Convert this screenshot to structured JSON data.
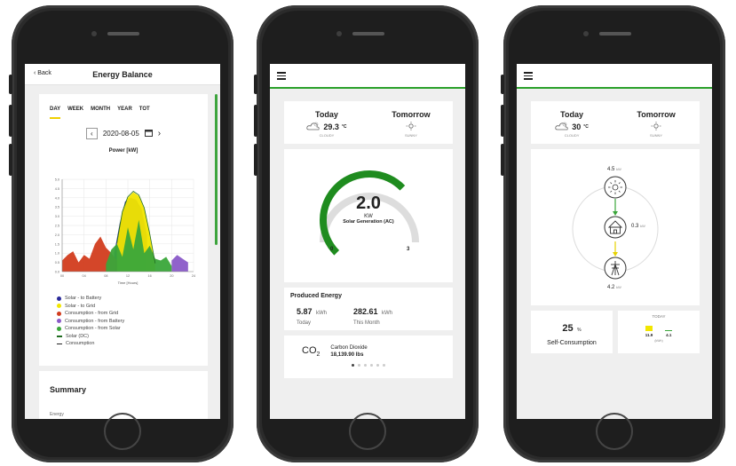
{
  "phone1": {
    "back_label": "Back",
    "title": "Energy Balance",
    "tabs": [
      "DAY",
      "WEEK",
      "MONTH",
      "YEAR",
      "TOT"
    ],
    "active_tab": "DAY",
    "date": "2020-08-05",
    "chart_title": "Power [kW]",
    "summary_title": "Summary",
    "summary_sub": "Energy",
    "chart_data": {
      "type": "area",
      "title": "Power [kW]",
      "xlabel": "Time [Hours]",
      "ylabel": "",
      "x_ticks": [
        "00",
        "04",
        "08",
        "12",
        "16",
        "20",
        "24"
      ],
      "y_ticks": [
        "0.0",
        "0.5",
        "1.0",
        "1.5",
        "2.0",
        "2.5",
        "3.0",
        "3.5",
        "4.0",
        "4.5",
        "5.0"
      ],
      "xlim": [
        0,
        24
      ],
      "ylim": [
        0,
        5
      ],
      "series": [
        {
          "name": "Solar - to Battery",
          "color": "#2a2a9a",
          "x": [
            9.5,
            10.5,
            11.5,
            12.5,
            13.5,
            14.5,
            15.5
          ],
          "y": [
            1.0,
            2.6,
            3.8,
            4.0,
            3.9,
            3.4,
            2.0
          ]
        },
        {
          "name": "Solar - to Grid",
          "color": "#f2e600",
          "x": [
            10,
            11,
            12,
            13,
            14,
            15,
            16,
            17
          ],
          "y": [
            1.5,
            3.2,
            4.0,
            4.3,
            4.1,
            3.4,
            2.0,
            0.4
          ]
        },
        {
          "name": "Consumption - from Grid",
          "color": "#d23c1e",
          "x": [
            0,
            1,
            2,
            3,
            4,
            5,
            6,
            7,
            8,
            9,
            10
          ],
          "y": [
            0.6,
            0.9,
            1.1,
            0.5,
            0.9,
            0.7,
            1.5,
            1.9,
            1.3,
            1.0,
            0.6
          ]
        },
        {
          "name": "Consumption - from Battery",
          "color": "#8a5ac8",
          "x": [
            20,
            21,
            22,
            23
          ],
          "y": [
            0.6,
            0.9,
            0.7,
            0.5
          ]
        },
        {
          "name": "Consumption - from Solar",
          "color": "#3aa63a",
          "x": [
            8,
            9,
            10,
            11,
            12,
            13,
            14,
            15,
            16,
            17,
            18,
            19,
            20
          ],
          "y": [
            0.4,
            1.2,
            1.5,
            0.8,
            2.4,
            1.2,
            2.8,
            1.0,
            1.4,
            0.7,
            0.6,
            0.8,
            0.3
          ]
        }
      ],
      "lines": [
        {
          "name": "Solar (DC)",
          "color": "#1f6b1f"
        },
        {
          "name": "Consumption",
          "color": "#222222"
        }
      ]
    }
  },
  "phone2": {
    "today_label": "Today",
    "tomorrow_label": "Tomorrow",
    "today_temp": "29.3",
    "temp_unit": "°C",
    "today_cond": "CLOUDY",
    "tomorrow_cond": "SUNNY",
    "gauge_value": "2.0",
    "gauge_unit": "KW",
    "gauge_label": "Solar Generation (AC)",
    "gauge_min": "0",
    "gauge_max": "3",
    "gauge_fraction": 0.67,
    "produced_title": "Produced Energy",
    "produced_today_value": "5.87",
    "produced_today_unit": "kWh",
    "produced_today_label": "Today",
    "produced_month_value": "282.61",
    "produced_month_unit": "kWh",
    "produced_month_label": "This Month",
    "co2_symbol": "CO",
    "co2_sub": "2",
    "co2_name": "Carbon Dioxide",
    "co2_value": "18,139.90 lbs",
    "page_dots": 6,
    "active_dot": 0
  },
  "phone3": {
    "today_label": "Today",
    "tomorrow_label": "Tomorrow",
    "today_temp": "30",
    "temp_unit": "°C",
    "today_cond": "CLOUDY",
    "tomorrow_cond": "SUNNY",
    "solar_value": "4.5",
    "solar_unit": "kW",
    "house_value": "0.3",
    "house_unit": "kW",
    "grid_value": "4.2",
    "grid_unit": "kW",
    "self_consumption_value": "25",
    "self_consumption_unit": "%",
    "self_consumption_label": "Self-Consumption",
    "today_caption": "TODAY",
    "mini_val_1": "11.9",
    "mini_val_2": "4.1",
    "mini_unit": "(kWh)",
    "mini_color_1": "#f2e600",
    "mini_color_2": "#3aa63a"
  }
}
